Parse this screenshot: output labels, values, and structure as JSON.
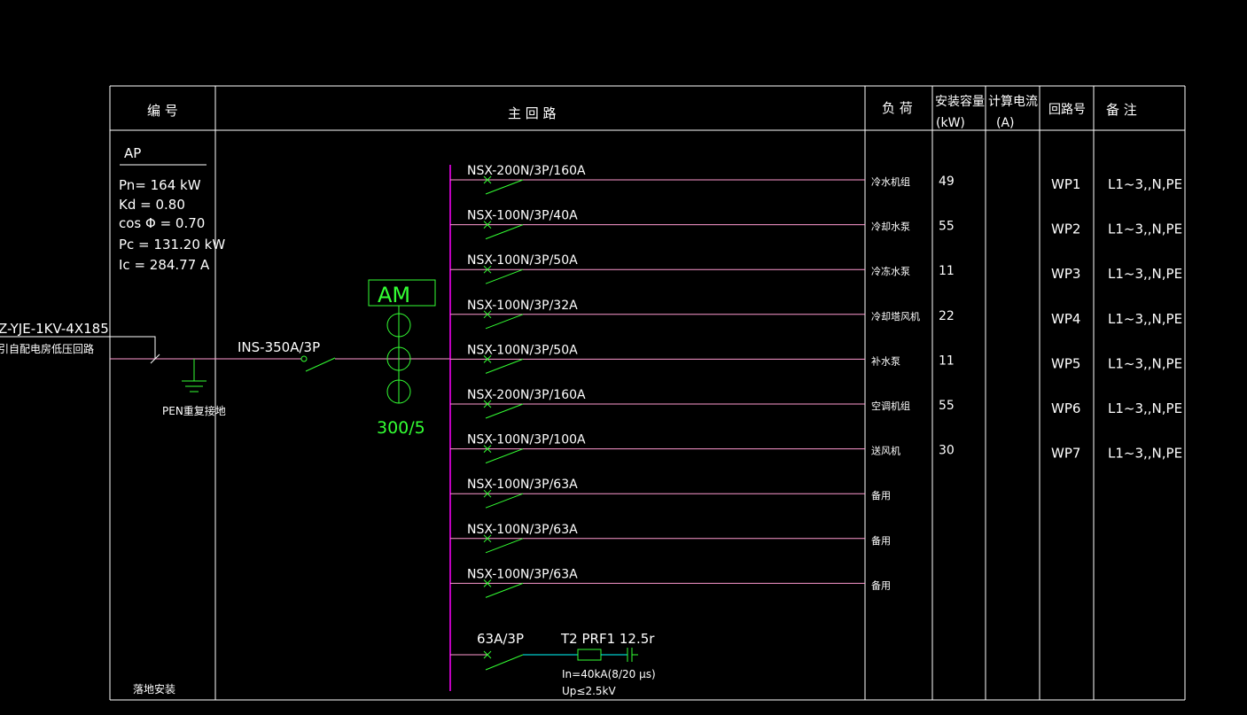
{
  "table": {
    "headers": [
      "编 号",
      "主 回 路",
      "负 荷",
      "安装容量",
      "(kW)",
      "计算电流",
      "(A)",
      "回路号",
      "备 注"
    ]
  },
  "panel": {
    "id": "AP",
    "params": [
      "Pn= 164 kW",
      "Kd = 0.80",
      "cos Φ = 0.70",
      "Pc = 131.20 kW",
      "Ic = 284.77 A"
    ],
    "install_note": "落地安装"
  },
  "incoming": {
    "cable": "Z-YJE-1KV-4X185",
    "source": "引自配电房低压回路",
    "main_switch": "INS-350A/3P",
    "pen_label": "PEN重复接地",
    "meter": "AM",
    "ct_ratio": "300/5"
  },
  "circuits": [
    {
      "breaker": "NSX-200N/3P/160A",
      "load": "冷水机组",
      "kw": "49",
      "id": "WP1",
      "note": "L1~3,,N,PE"
    },
    {
      "breaker": "NSX-100N/3P/40A",
      "load": "冷却水泵",
      "kw": "55",
      "id": "WP2",
      "note": "L1~3,,N,PE"
    },
    {
      "breaker": "NSX-100N/3P/50A",
      "load": "冷冻水泵",
      "kw": "11",
      "id": "WP3",
      "note": "L1~3,,N,PE"
    },
    {
      "breaker": "NSX-100N/3P/32A",
      "load": "冷却塔风机",
      "kw": "22",
      "id": "WP4",
      "note": "L1~3,,N,PE"
    },
    {
      "breaker": "NSX-100N/3P/50A",
      "load": "补水泵",
      "kw": "11",
      "id": "WP5",
      "note": "L1~3,,N,PE"
    },
    {
      "breaker": "NSX-200N/3P/160A",
      "load": "空调机组",
      "kw": "55",
      "id": "WP6",
      "note": "L1~3,,N,PE"
    },
    {
      "breaker": "NSX-100N/3P/100A",
      "load": "送风机",
      "kw": "30",
      "id": "WP7",
      "note": "L1~3,,N,PE"
    },
    {
      "breaker": "NSX-100N/3P/63A",
      "load": "备用",
      "kw": "",
      "id": "",
      "note": ""
    },
    {
      "breaker": "NSX-100N/3P/63A",
      "load": "备用",
      "kw": "",
      "id": "",
      "note": ""
    },
    {
      "breaker": "NSX-100N/3P/63A",
      "load": "备用",
      "kw": "",
      "id": "",
      "note": ""
    }
  ],
  "spd": {
    "breaker": "63A/3P",
    "model": "T2 PRF1 12.5r",
    "in": "In=40kA(8/20 μs)",
    "up": "Up≤2.5kV"
  },
  "colors": {
    "background": "#000000",
    "grid": "#ffffff",
    "busbar": "#ff00ff",
    "feeder": "#ff9ad0",
    "breaker": "#33ff33",
    "spd_wire": "#00ffff"
  }
}
